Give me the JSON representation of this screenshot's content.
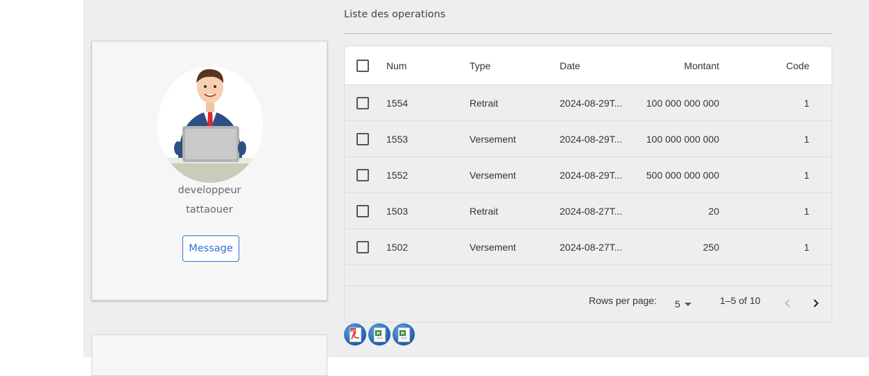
{
  "profile": {
    "role": "developpeur",
    "name": "tattaouer",
    "message_label": "Message"
  },
  "operations": {
    "title": "Liste des operations",
    "columns": [
      "Num",
      "Type",
      "Date",
      "Montant",
      "Code"
    ],
    "rows": [
      {
        "num": "1554",
        "type": "Retrait",
        "date": "2024-08-29T...",
        "montant": "100 000 000 000",
        "code": "1"
      },
      {
        "num": "1553",
        "type": "Versement",
        "date": "2024-08-29T...",
        "montant": "100 000 000 000",
        "code": "1"
      },
      {
        "num": "1552",
        "type": "Versement",
        "date": "2024-08-29T...",
        "montant": "500 000 000 000",
        "code": "1"
      },
      {
        "num": "1503",
        "type": "Retrait",
        "date": "2024-08-27T...",
        "montant": "20",
        "code": "1"
      },
      {
        "num": "1502",
        "type": "Versement",
        "date": "2024-08-27T...",
        "montant": "250",
        "code": "1"
      }
    ],
    "pagination": {
      "rows_per_page_label": "Rows per page:",
      "rows_per_page_value": "5",
      "range_text": "1–5 of 10"
    }
  },
  "exports": [
    {
      "icon": "pdf-export-icon",
      "label": "PDF"
    },
    {
      "icon": "excel-export-icon"
    },
    {
      "icon": "excel-export-icon"
    }
  ],
  "colors": {
    "accent": "#2f6fd6",
    "background": "#eeeeee"
  }
}
